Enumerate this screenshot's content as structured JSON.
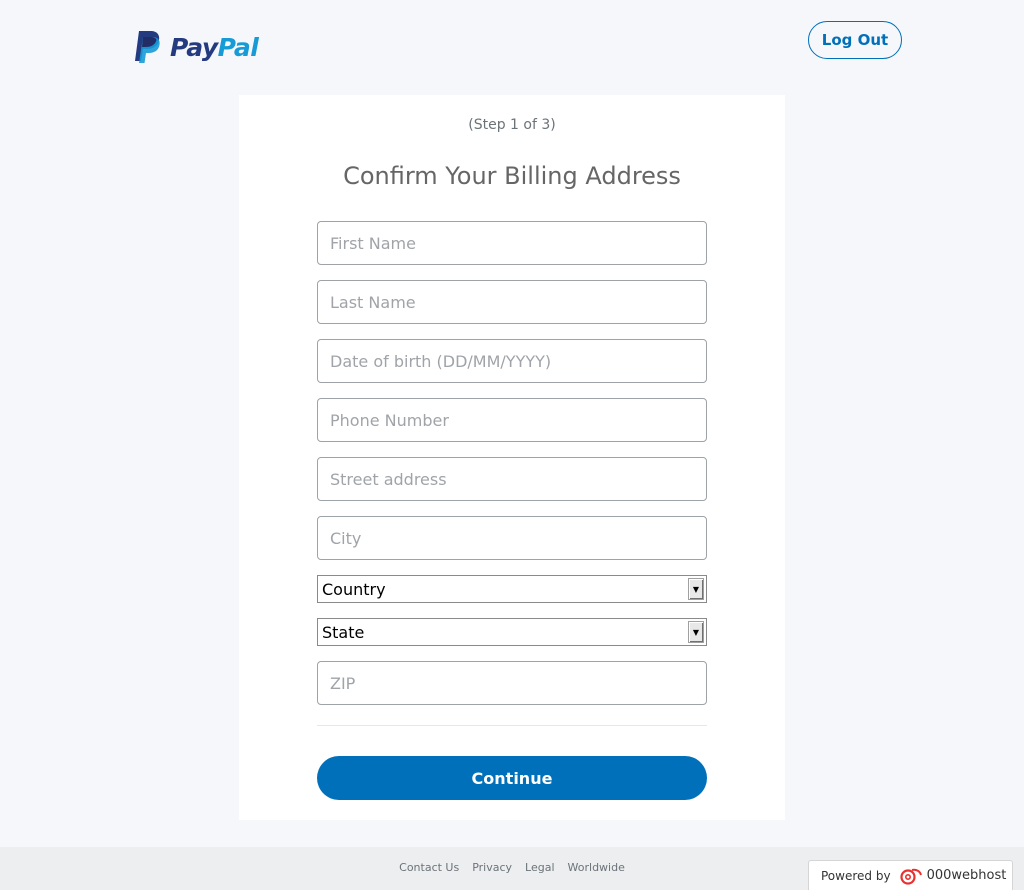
{
  "header": {
    "logo_pay": "Pay",
    "logo_pal": "Pal",
    "logout_label": "Log Out"
  },
  "form": {
    "step": "(Step 1 of 3)",
    "title": "Confirm Your Billing Address",
    "first_name_placeholder": "First Name",
    "last_name_placeholder": "Last Name",
    "dob_placeholder": "Date of birth (DD/MM/YYYY)",
    "phone_placeholder": "Phone Number",
    "street_placeholder": "Street address",
    "city_placeholder": "City",
    "country_selected": "Country",
    "state_selected": "State",
    "zip_placeholder": "ZIP",
    "continue_label": "Continue"
  },
  "footer": {
    "links": [
      "Contact Us",
      "Privacy",
      "Legal",
      "Worldwide"
    ]
  },
  "badge": {
    "prefix": "Powered by",
    "brand": "000webhost"
  },
  "colors": {
    "brand_dark": "#253b80",
    "brand_light": "#179bd7",
    "button_blue": "#0070ba",
    "background": "#f5f7fa"
  }
}
